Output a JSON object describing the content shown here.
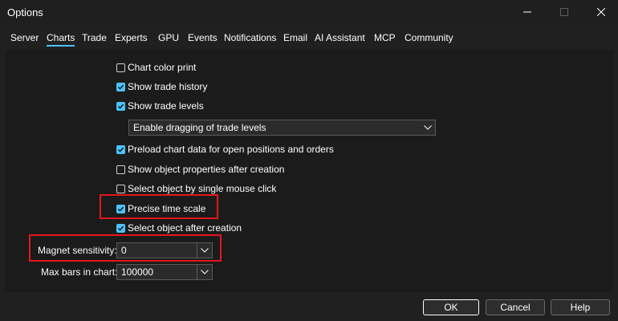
{
  "window": {
    "title": "Options"
  },
  "tabs": [
    {
      "label": "Server",
      "active": false
    },
    {
      "label": "Charts",
      "active": true
    },
    {
      "label": "Trade",
      "active": false
    },
    {
      "label": "Experts",
      "active": false
    },
    {
      "label": "GPU",
      "active": false
    },
    {
      "label": "Events",
      "active": false
    },
    {
      "label": "Notifications",
      "active": false
    },
    {
      "label": "Email",
      "active": false
    },
    {
      "label": "AI Assistant",
      "active": false
    },
    {
      "label": "MCP",
      "active": false
    },
    {
      "label": "Community",
      "active": false
    }
  ],
  "options": [
    {
      "label": "Chart color print",
      "checked": false
    },
    {
      "label": "Show trade history",
      "checked": true
    },
    {
      "label": "Show trade levels",
      "checked": true
    },
    {
      "label": "Preload chart data for open positions and orders",
      "checked": true
    },
    {
      "label": "Show object properties after creation",
      "checked": false
    },
    {
      "label": "Select object by single mouse click",
      "checked": false
    },
    {
      "label": "Precise time scale",
      "checked": true
    },
    {
      "label": "Select object after creation",
      "checked": true
    }
  ],
  "trade_levels_select": {
    "value": "Enable dragging of trade levels"
  },
  "magnet": {
    "label": "Magnet sensitivity:",
    "value": "0"
  },
  "max_bars": {
    "label": "Max bars in chart:",
    "value": "100000"
  },
  "buttons": {
    "ok": "OK",
    "cancel": "Cancel",
    "help": "Help"
  },
  "colors": {
    "accent": "#4cc2ff",
    "highlight": "#e5161c",
    "background": "#202020"
  }
}
